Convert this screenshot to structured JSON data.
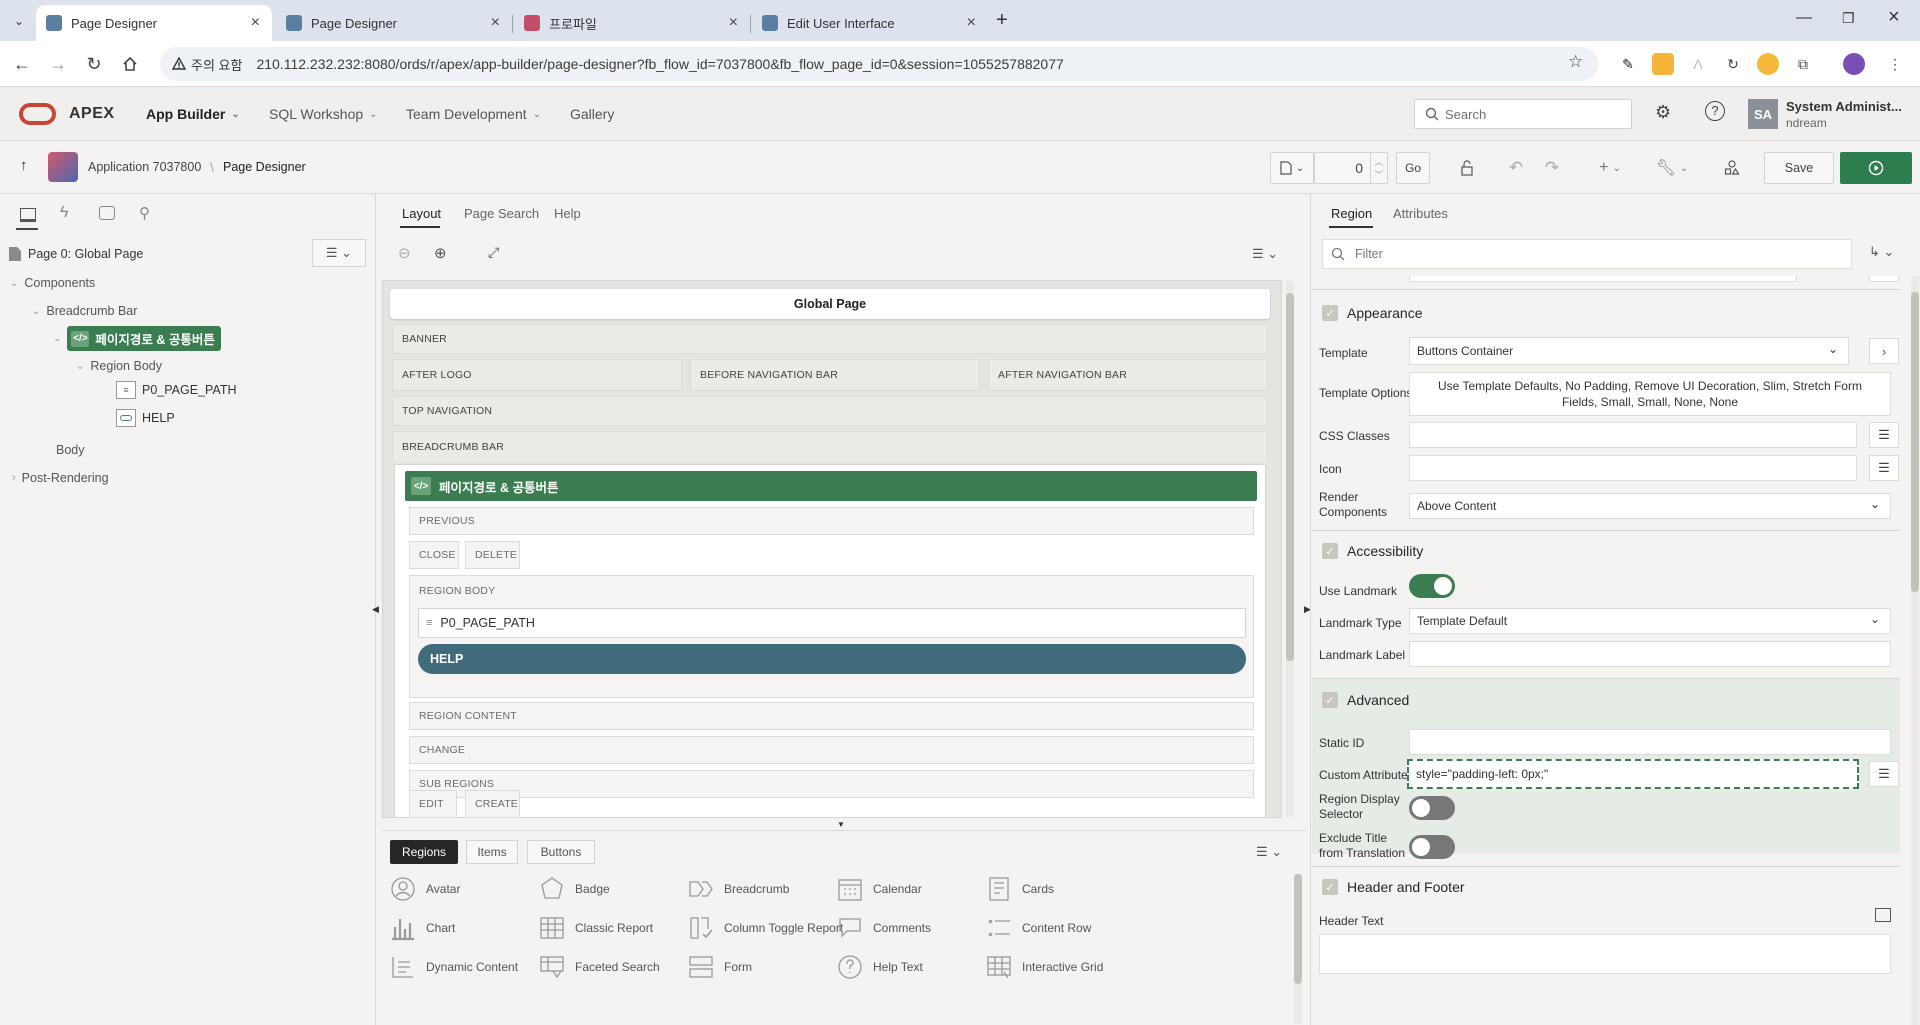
{
  "browser": {
    "tabs": [
      {
        "title": "Page Designer",
        "active": true
      },
      {
        "title": "Page Designer",
        "active": false
      },
      {
        "title": "프로파일",
        "active": false
      },
      {
        "title": "Edit User Interface",
        "active": false
      }
    ],
    "security_label": "주의 요함",
    "url": "210.112.232.232:8080/ords/r/apex/app-builder/page-designer?fb_flow_id=7037800&fb_flow_page_id=0&session=1055257882077"
  },
  "apex": {
    "logo": "APEX",
    "nav": [
      "App Builder",
      "SQL Workshop",
      "Team Development",
      "Gallery"
    ],
    "search_placeholder": "Search",
    "user_initials": "SA",
    "user_name": "System Administ...",
    "user_workspace": "ndream"
  },
  "toolbar": {
    "app_label": "Application 7037800",
    "page_designer": "Page Designer",
    "page_number": "0",
    "go": "Go",
    "save": "Save"
  },
  "left": {
    "page_title": "Page 0: Global Page",
    "tree": {
      "components": "Components",
      "breadcrumb_bar": "Breadcrumb Bar",
      "region": "페이지경로 & 공통버튼",
      "region_body": "Region Body",
      "item1": "P0_PAGE_PATH",
      "item2": "HELP",
      "body": "Body",
      "post_rendering": "Post-Rendering"
    }
  },
  "center": {
    "tabs": [
      "Layout",
      "Page Search",
      "Help"
    ],
    "global_page": "Global Page",
    "slots": {
      "banner": "BANNER",
      "after_logo": "AFTER LOGO",
      "before_nav": "BEFORE NAVIGATION BAR",
      "after_nav": "AFTER NAVIGATION BAR",
      "top_nav": "TOP NAVIGATION",
      "breadcrumb_bar": "BREADCRUMB BAR",
      "previous": "PREVIOUS",
      "close": "CLOSE",
      "delete": "DELETE",
      "region_body": "REGION BODY",
      "region_content": "REGION CONTENT",
      "change": "CHANGE",
      "sub_regions": "SUB REGIONS",
      "edit": "EDIT",
      "create": "CREATE"
    },
    "region_title": "페이지경로 & 공통버튼",
    "item_page_path": "P0_PAGE_PATH",
    "item_help": "HELP",
    "gallery_tabs": [
      "Regions",
      "Items",
      "Buttons"
    ],
    "gallery": [
      {
        "label": "Avatar",
        "icon": "avatar-icon"
      },
      {
        "label": "Badge",
        "icon": "badge-icon"
      },
      {
        "label": "Breadcrumb",
        "icon": "breadcrumb-icon"
      },
      {
        "label": "Calendar",
        "icon": "calendar-icon"
      },
      {
        "label": "Cards",
        "icon": "cards-icon"
      },
      {
        "label": "Chart",
        "icon": "chart-icon"
      },
      {
        "label": "Classic Report",
        "icon": "classic-report-icon"
      },
      {
        "label": "Column Toggle Report",
        "icon": "column-toggle-icon"
      },
      {
        "label": "Comments",
        "icon": "comments-icon"
      },
      {
        "label": "Content Row",
        "icon": "content-row-icon"
      },
      {
        "label": "Dynamic Content",
        "icon": "dynamic-content-icon"
      },
      {
        "label": "Faceted Search",
        "icon": "faceted-search-icon"
      },
      {
        "label": "Form",
        "icon": "form-icon"
      },
      {
        "label": "Help Text",
        "icon": "help-text-icon"
      },
      {
        "label": "Interactive Grid",
        "icon": "interactive-grid-icon"
      }
    ]
  },
  "right": {
    "tabs": [
      "Region",
      "Attributes"
    ],
    "filter_placeholder": "Filter",
    "appearance": {
      "title": "Appearance",
      "template_label": "Template",
      "template_value": "Buttons Container",
      "template_options_label": "Template Options",
      "template_options_value": "Use Template Defaults, No Padding, Remove UI Decoration, Slim, Stretch Form Fields, Small, Small, None, None",
      "css_classes_label": "CSS Classes",
      "icon_label": "Icon",
      "render_components_label": "Render Components",
      "render_components_value": "Above Content"
    },
    "accessibility": {
      "title": "Accessibility",
      "use_landmark_label": "Use Landmark",
      "use_landmark": true,
      "landmark_type_label": "Landmark Type",
      "landmark_type_value": "Template Default",
      "landmark_label_label": "Landmark Label"
    },
    "advanced": {
      "title": "Advanced",
      "static_id_label": "Static ID",
      "custom_attributes_label": "Custom Attributes",
      "custom_attributes_value": "style=\"padding-left: 0px;\"",
      "region_display_selector_label": "Region Display Selector",
      "region_display_selector": false,
      "exclude_title_label": "Exclude Title from Translation",
      "exclude_title": false
    },
    "header_footer": {
      "title": "Header and Footer",
      "header_text_label": "Header Text"
    }
  },
  "colors": {
    "apex_red": "#c74634",
    "green": "#3a7d50",
    "help_teal": "#3f6b7a",
    "save_green": "#2e7d4c"
  }
}
